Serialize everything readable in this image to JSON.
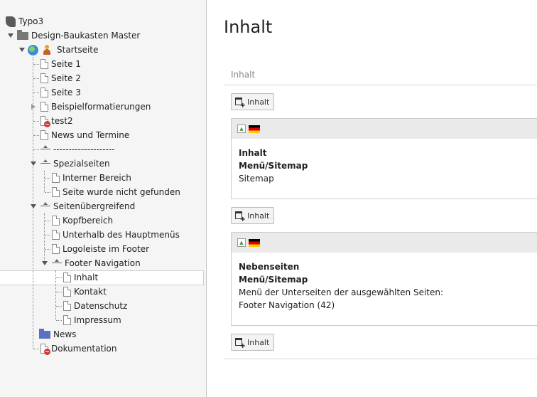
{
  "tree": {
    "root": "Typo3",
    "site": "Design-Baukasten Master",
    "startpage": "Startseite",
    "pages": [
      "Seite 1",
      "Seite 2",
      "Seite 3",
      "Beispielformatierungen",
      "test2",
      "News und Termine",
      "--------------------"
    ],
    "spezial": {
      "label": "Spezialseiten",
      "children": [
        "Interner Bereich",
        "Seite wurde nicht gefunden"
      ]
    },
    "global": {
      "label": "Seitenübergreifend",
      "children": [
        "Kopfbereich",
        "Unterhalb des Hauptmenüs",
        "Logoleiste im Footer"
      ]
    },
    "footer": {
      "label": "Footer Navigation",
      "children": [
        "Inhalt",
        "Kontakt",
        "Datenschutz",
        "Impressum"
      ]
    },
    "news": "News",
    "doku": "Dokumentation"
  },
  "content": {
    "title": "Inhalt",
    "column_header": "Inhalt",
    "new_button_label": "Inhalt",
    "elements": [
      {
        "header": "Inhalt",
        "type": "Menü/Sitemap",
        "lines": [
          "Sitemap"
        ]
      },
      {
        "header": "Nebenseiten",
        "type": "Menü/Sitemap",
        "lines": [
          "Menü der Unterseiten der ausgewählten Seiten:",
          "Footer Navigation (42)"
        ]
      }
    ]
  }
}
